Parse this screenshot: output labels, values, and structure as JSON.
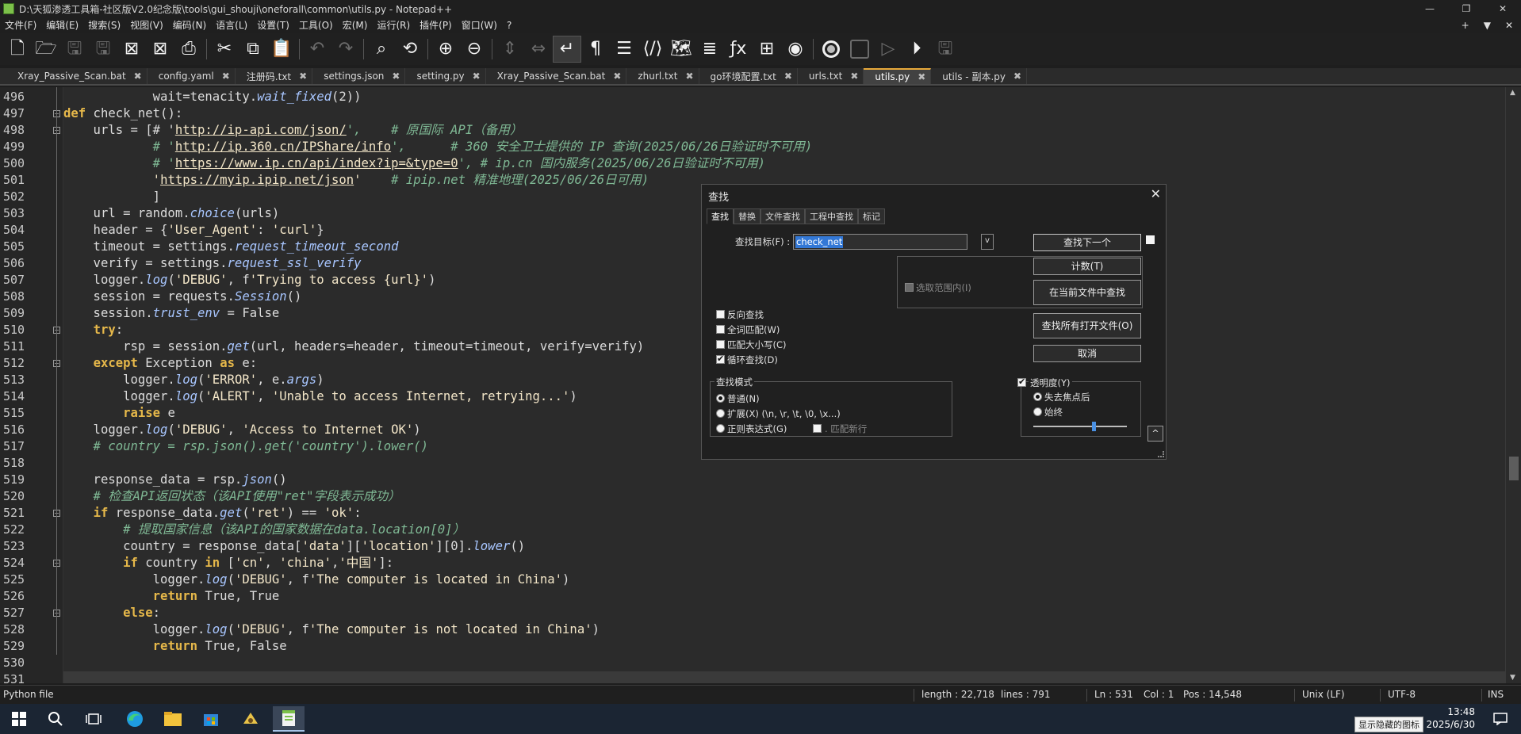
{
  "window": {
    "title": "D:\\天狐渗透工具箱-社区版V2.0纪念版\\tools\\gui_shouji\\oneforall\\common\\utils.py - Notepad++",
    "controls": [
      "—",
      "❐",
      "✕"
    ]
  },
  "menu": {
    "items": [
      "文件(F)",
      "编辑(E)",
      "搜索(S)",
      "视图(V)",
      "编码(N)",
      "语言(L)",
      "设置(T)",
      "工具(O)",
      "宏(M)",
      "运行(R)",
      "插件(P)",
      "窗口(W)",
      "?"
    ],
    "right": [
      "+",
      "▼",
      "✕"
    ]
  },
  "toolbar": {
    "icons": [
      "new-file-icon",
      "open-folder-icon",
      "save-icon",
      "save-all-icon",
      "close-icon",
      "close-all-icon",
      "print-icon",
      "cut-icon",
      "copy-icon",
      "paste-icon",
      "undo-icon",
      "redo-icon",
      "find-icon",
      "replace-icon",
      "zoom-in-icon",
      "zoom-out-icon",
      "sync-vertical-icon",
      "sync-horizontal-icon",
      "word-wrap-icon",
      "show-all-chars-icon",
      "indent-guide-icon",
      "xml-tag-icon",
      "document-map-icon",
      "function-list-icon",
      "function-icon",
      "folder-workspace-icon",
      "monitoring-icon",
      "record-macro-icon",
      "stop-macro-icon",
      "play-macro-icon",
      "run-macro-multiple-icon",
      "save-macro-icon"
    ]
  },
  "tabs": [
    {
      "label": "Xray_Passive_Scan.bat",
      "active": false
    },
    {
      "label": "config.yaml",
      "active": false
    },
    {
      "label": "注册码.txt",
      "active": false
    },
    {
      "label": "settings.json",
      "active": false
    },
    {
      "label": "setting.py",
      "active": false
    },
    {
      "label": "Xray_Passive_Scan.bat",
      "active": false
    },
    {
      "label": "zhurl.txt",
      "active": false
    },
    {
      "label": "go环境配置.txt",
      "active": false
    },
    {
      "label": "urls.txt",
      "active": false
    },
    {
      "label": "utils.py",
      "active": true
    },
    {
      "label": "utils - 副本.py",
      "active": false
    }
  ],
  "editor": {
    "lines": [
      {
        "n": "496",
        "fold": "",
        "segs": [
          [
            "t",
            "            wait=tenacity."
          ],
          [
            "it",
            "wait_fixed"
          ],
          [
            "t",
            "(2))"
          ]
        ]
      },
      {
        "n": "497",
        "fold": "minus",
        "segs": [
          [
            "kw",
            "def"
          ],
          [
            "t",
            " check_net():"
          ]
        ]
      },
      {
        "n": "498",
        "fold": "minus",
        "segs": [
          [
            "t",
            "    urls = [# '"
          ],
          [
            "url",
            "http://ip-api.com/json/"
          ],
          [
            "cmt",
            "',    # 原国际 API（备用）"
          ]
        ]
      },
      {
        "n": "499",
        "fold": "",
        "segs": [
          [
            "cmt",
            "            # '"
          ],
          [
            "url",
            "http://ip.360.cn/IPShare/info"
          ],
          [
            "cmt",
            "',      # 360 安全卫士提供的 IP 查询(2025/06/26日验证时不可用)"
          ]
        ]
      },
      {
        "n": "500",
        "fold": "",
        "segs": [
          [
            "cmt",
            "            # '"
          ],
          [
            "url",
            "https://www.ip.cn/api/index?ip=&type=0"
          ],
          [
            "cmt",
            "', # ip.cn 国内服务(2025/06/26日验证时不可用)"
          ]
        ]
      },
      {
        "n": "501",
        "fold": "",
        "segs": [
          [
            "str",
            "            '"
          ],
          [
            "url",
            "https://myip.ipip.net/json"
          ],
          [
            "str",
            "'"
          ],
          [
            "cmt",
            "    # ipip.net 精准地理(2025/06/26日可用)"
          ]
        ]
      },
      {
        "n": "502",
        "fold": "",
        "segs": [
          [
            "t",
            "            ]"
          ]
        ]
      },
      {
        "n": "503",
        "fold": "",
        "segs": [
          [
            "t",
            "    url = random."
          ],
          [
            "it",
            "choice"
          ],
          [
            "t",
            "(urls)"
          ]
        ]
      },
      {
        "n": "504",
        "fold": "",
        "segs": [
          [
            "t",
            "    header = {"
          ],
          [
            "str",
            "'User_Agent'"
          ],
          [
            "t",
            ": "
          ],
          [
            "str",
            "'curl'"
          ],
          [
            "t",
            "}"
          ]
        ]
      },
      {
        "n": "505",
        "fold": "",
        "segs": [
          [
            "t",
            "    timeout = settings."
          ],
          [
            "it",
            "request_timeout_second"
          ]
        ]
      },
      {
        "n": "506",
        "fold": "",
        "segs": [
          [
            "t",
            "    verify = settings."
          ],
          [
            "it",
            "request_ssl_verify"
          ]
        ]
      },
      {
        "n": "507",
        "fold": "",
        "segs": [
          [
            "t",
            "    logger."
          ],
          [
            "it",
            "log"
          ],
          [
            "t",
            "("
          ],
          [
            "str",
            "'DEBUG'"
          ],
          [
            "t",
            ", f"
          ],
          [
            "str",
            "'Trying to access {url}'"
          ],
          [
            "t",
            ")"
          ]
        ]
      },
      {
        "n": "508",
        "fold": "",
        "segs": [
          [
            "t",
            "    session = requests."
          ],
          [
            "it",
            "Session"
          ],
          [
            "t",
            "()"
          ]
        ]
      },
      {
        "n": "509",
        "fold": "",
        "segs": [
          [
            "t",
            "    session."
          ],
          [
            "it",
            "trust_env"
          ],
          [
            "t",
            " = False"
          ]
        ]
      },
      {
        "n": "510",
        "fold": "minus",
        "segs": [
          [
            "t",
            "    "
          ],
          [
            "kw",
            "try"
          ],
          [
            "t",
            ":"
          ]
        ]
      },
      {
        "n": "511",
        "fold": "",
        "segs": [
          [
            "t",
            "        rsp = session."
          ],
          [
            "it",
            "get"
          ],
          [
            "t",
            "(url, headers=header, timeout=timeout, verify=verify)"
          ]
        ]
      },
      {
        "n": "512",
        "fold": "minus",
        "segs": [
          [
            "t",
            "    "
          ],
          [
            "kw",
            "except"
          ],
          [
            "t",
            " Exception "
          ],
          [
            "kw",
            "as"
          ],
          [
            "t",
            " e:"
          ]
        ]
      },
      {
        "n": "513",
        "fold": "",
        "segs": [
          [
            "t",
            "        logger."
          ],
          [
            "it",
            "log"
          ],
          [
            "t",
            "("
          ],
          [
            "str",
            "'ERROR'"
          ],
          [
            "t",
            ", e."
          ],
          [
            "it",
            "args"
          ],
          [
            "t",
            ")"
          ]
        ]
      },
      {
        "n": "514",
        "fold": "",
        "segs": [
          [
            "t",
            "        logger."
          ],
          [
            "it",
            "log"
          ],
          [
            "t",
            "("
          ],
          [
            "str",
            "'ALERT'"
          ],
          [
            "t",
            ", "
          ],
          [
            "str",
            "'Unable to access Internet, retrying...'"
          ],
          [
            "t",
            ")"
          ]
        ]
      },
      {
        "n": "515",
        "fold": "",
        "segs": [
          [
            "t",
            "        "
          ],
          [
            "kw",
            "raise"
          ],
          [
            "t",
            " e"
          ]
        ]
      },
      {
        "n": "516",
        "fold": "",
        "segs": [
          [
            "t",
            "    logger."
          ],
          [
            "it",
            "log"
          ],
          [
            "t",
            "("
          ],
          [
            "str",
            "'DEBUG'"
          ],
          [
            "t",
            ", "
          ],
          [
            "str",
            "'Access to Internet OK'"
          ],
          [
            "t",
            ")"
          ]
        ]
      },
      {
        "n": "517",
        "fold": "",
        "segs": [
          [
            "cmt",
            "    # country = rsp.json().get('country').lower()"
          ]
        ]
      },
      {
        "n": "518",
        "fold": "",
        "segs": [
          [
            "t",
            ""
          ]
        ]
      },
      {
        "n": "519",
        "fold": "",
        "segs": [
          [
            "t",
            "    response_data = rsp."
          ],
          [
            "it",
            "json"
          ],
          [
            "t",
            "()"
          ]
        ]
      },
      {
        "n": "520",
        "fold": "",
        "segs": [
          [
            "cmt",
            "    # 检查API返回状态（该API使用\"ret\"字段表示成功）"
          ]
        ]
      },
      {
        "n": "521",
        "fold": "minus",
        "segs": [
          [
            "t",
            "    "
          ],
          [
            "kw",
            "if"
          ],
          [
            "t",
            " response_data."
          ],
          [
            "it",
            "get"
          ],
          [
            "t",
            "("
          ],
          [
            "str",
            "'ret'"
          ],
          [
            "t",
            ") == "
          ],
          [
            "str",
            "'ok'"
          ],
          [
            "t",
            ":"
          ]
        ]
      },
      {
        "n": "522",
        "fold": "",
        "segs": [
          [
            "cmt",
            "        # 提取国家信息（该API的国家数据在data.location[0]）"
          ]
        ]
      },
      {
        "n": "523",
        "fold": "",
        "segs": [
          [
            "t",
            "        country = response_data["
          ],
          [
            "str",
            "'data'"
          ],
          [
            "t",
            "]["
          ],
          [
            "str",
            "'location'"
          ],
          [
            "t",
            "][0]."
          ],
          [
            "it",
            "lower"
          ],
          [
            "t",
            "()"
          ]
        ]
      },
      {
        "n": "524",
        "fold": "minus",
        "segs": [
          [
            "t",
            "        "
          ],
          [
            "kw",
            "if"
          ],
          [
            "t",
            " country "
          ],
          [
            "kw",
            "in"
          ],
          [
            "t",
            " ["
          ],
          [
            "str",
            "'cn'"
          ],
          [
            "t",
            ", "
          ],
          [
            "str",
            "'china'"
          ],
          [
            "t",
            ","
          ],
          [
            "str",
            "'中国'"
          ],
          [
            "t",
            "]:"
          ]
        ]
      },
      {
        "n": "525",
        "fold": "",
        "segs": [
          [
            "t",
            "            logger."
          ],
          [
            "it",
            "log"
          ],
          [
            "t",
            "("
          ],
          [
            "str",
            "'DEBUG'"
          ],
          [
            "t",
            ", f"
          ],
          [
            "str",
            "'The computer is located in China'"
          ],
          [
            "t",
            ")"
          ]
        ]
      },
      {
        "n": "526",
        "fold": "",
        "segs": [
          [
            "t",
            "            "
          ],
          [
            "kw",
            "return"
          ],
          [
            "t",
            " True, True"
          ]
        ]
      },
      {
        "n": "527",
        "fold": "minus",
        "segs": [
          [
            "t",
            "        "
          ],
          [
            "kw",
            "else"
          ],
          [
            "t",
            ":"
          ]
        ]
      },
      {
        "n": "528",
        "fold": "",
        "segs": [
          [
            "t",
            "            logger."
          ],
          [
            "it",
            "log"
          ],
          [
            "t",
            "("
          ],
          [
            "str",
            "'DEBUG'"
          ],
          [
            "t",
            ", f"
          ],
          [
            "str",
            "'The computer is not located in China'"
          ],
          [
            "t",
            ")"
          ]
        ]
      },
      {
        "n": "529",
        "fold": "",
        "segs": [
          [
            "t",
            "            "
          ],
          [
            "kw",
            "return"
          ],
          [
            "t",
            " True, False"
          ]
        ]
      },
      {
        "n": "530",
        "fold": "",
        "segs": [
          [
            "t",
            ""
          ]
        ]
      },
      {
        "n": "531",
        "fold": "",
        "segs": [
          [
            "t",
            ""
          ]
        ]
      }
    ],
    "current_line": "531"
  },
  "find_dialog": {
    "title": "查找",
    "tabs": [
      {
        "label": "查找",
        "active": true
      },
      {
        "label": "替换",
        "active": false
      },
      {
        "label": "文件查找",
        "active": false
      },
      {
        "label": "工程中查找",
        "active": false
      },
      {
        "label": "标记",
        "active": false
      }
    ],
    "target_label": "查找目标(F) :",
    "target_value": "check_net",
    "in_selection_label": "选取范围内(I)",
    "buttons": {
      "find_next": "查找下一个",
      "count": "计数(T)",
      "find_in_current": "在当前文件中查找",
      "find_in_all_open": "查找所有打开文件(O)",
      "cancel": "取消"
    },
    "options": [
      {
        "label": "反向查找",
        "checked": false
      },
      {
        "label": "全词匹配(W)",
        "checked": false
      },
      {
        "label": "匹配大小写(C)",
        "checked": false
      },
      {
        "label": "循环查找(D)",
        "checked": true
      }
    ],
    "search_mode": {
      "title": "查找模式",
      "normal": "普通(N)",
      "extended": "扩展(X) (\\n, \\r, \\t, \\0, \\x...)",
      "regex": "正则表达式(G)",
      "dot_newline": ". 匹配新行",
      "selected": "normal"
    },
    "transparency": {
      "label": "透明度(Y)",
      "checked": true,
      "on_lose_focus": "失去焦点后",
      "always": "始终",
      "selected": "on_lose_focus",
      "level": 0.6
    }
  },
  "statusbar": {
    "file_type": "Python file",
    "length": "length : 22,718",
    "lines": "lines : 791",
    "ln": "Ln : 531",
    "col": "Col : 1",
    "pos": "Pos : 14,548",
    "eol": "Unix (LF)",
    "encoding": "UTF-8",
    "ins": "INS"
  },
  "taskbar": {
    "time": "13:48",
    "date": "2025/6/30",
    "tooltip": "显示隐藏的图标"
  },
  "colors": {
    "keyword": "#e6b84a",
    "comment": "#7fb894",
    "string": "#f3e6c8",
    "method": "#a8c6ff",
    "selection": "#3378d6",
    "active_tab_accent": "#e6a83a"
  }
}
